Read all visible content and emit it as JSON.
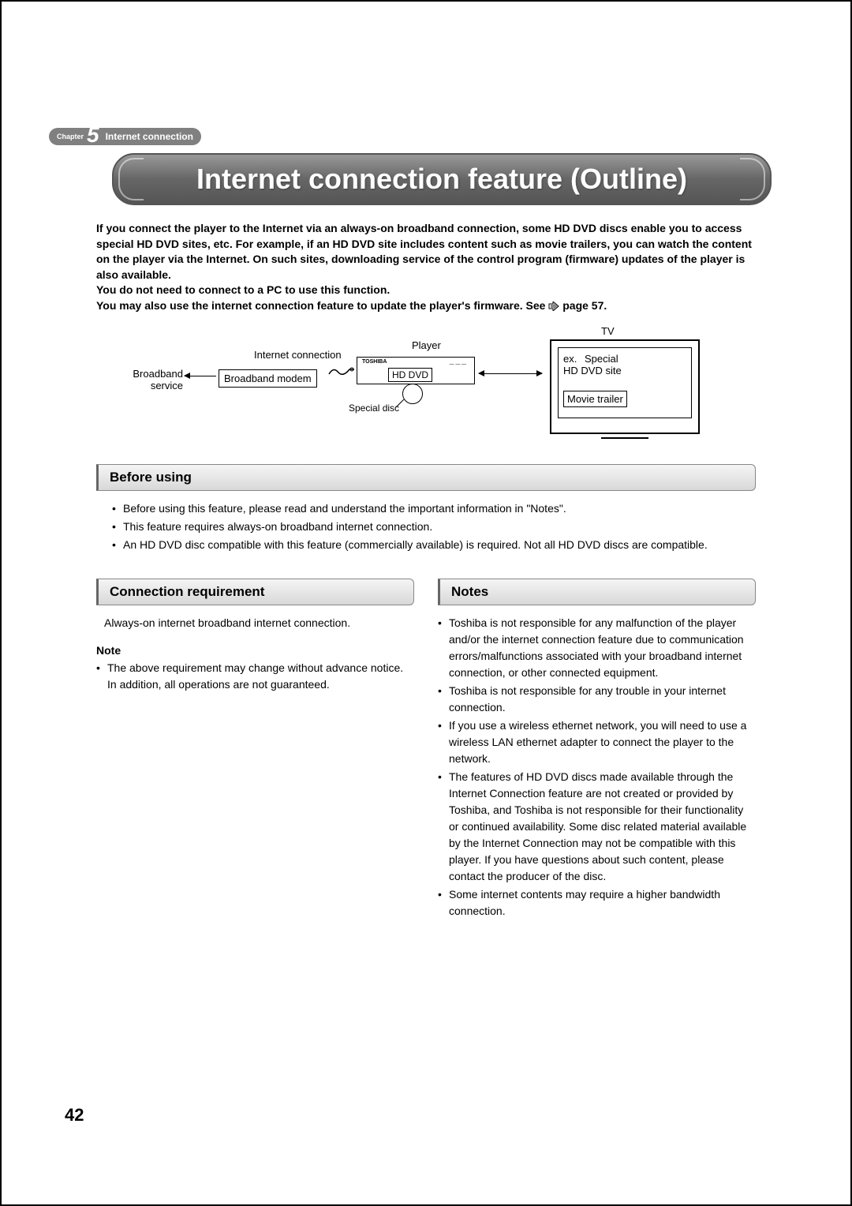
{
  "chapter": {
    "label": "Chapter",
    "number": "5",
    "title": "Internet connection"
  },
  "page_title": "Internet connection feature (Outline)",
  "intro": {
    "p1": "If you connect the player to the Internet via an always-on broadband connection, some HD DVD discs enable you to access special HD DVD sites, etc. For example, if an HD DVD site includes content such as movie trailers, you can watch the content on the player via the Internet. On such sites, downloading service of the control program (firmware) updates of the player is also available.",
    "p2": "You do not need to connect to a PC to use this function.",
    "p3_a": "You may also use the internet connection feature to update the player's firmware. See ",
    "p3_b": " page 57."
  },
  "diagram": {
    "broadband_service": "Broadband service",
    "internet_connection": "Internet connection",
    "broadband_modem": "Broadband modem",
    "player": "Player",
    "hd_dvd": "HD DVD",
    "special_disc": "Special disc",
    "tv": "TV",
    "ex": "ex.",
    "special_site": "Special HD DVD site",
    "movie_trailer": "Movie trailer"
  },
  "sections": {
    "before_using": {
      "title": "Before using",
      "items": [
        "Before using this feature, please read and understand the important information in \"Notes\".",
        "This feature requires always-on broadband internet connection.",
        "An HD DVD disc compatible with this feature (commercially available) is required. Not all HD DVD discs are compatible."
      ]
    },
    "connection_req": {
      "title": "Connection requirement",
      "text": "Always-on internet broadband internet connection.",
      "note_label": "Note",
      "note_items": [
        "The above requirement may change without advance notice. In addition, all operations are not guaranteed."
      ]
    },
    "notes": {
      "title": "Notes",
      "items": [
        "Toshiba is not responsible for any malfunction of the player and/or the internet connection feature due to communication errors/malfunctions associated with your broadband internet connection, or other connected equipment.",
        "Toshiba is not responsible for any trouble in your internet connection.",
        "If you use a wireless ethernet network, you will need to use a wireless LAN ethernet adapter to connect the player to the network.",
        "The features of HD DVD discs made available through the Internet Connection feature are not created or provided by Toshiba, and Toshiba is not responsible for their functionality or continued availability. Some disc related material available by the Internet Connection may not be compatible with this player. If you have questions about such content, please contact the producer of the disc.",
        "Some internet contents may require a higher bandwidth connection."
      ]
    }
  },
  "page_number": "42"
}
